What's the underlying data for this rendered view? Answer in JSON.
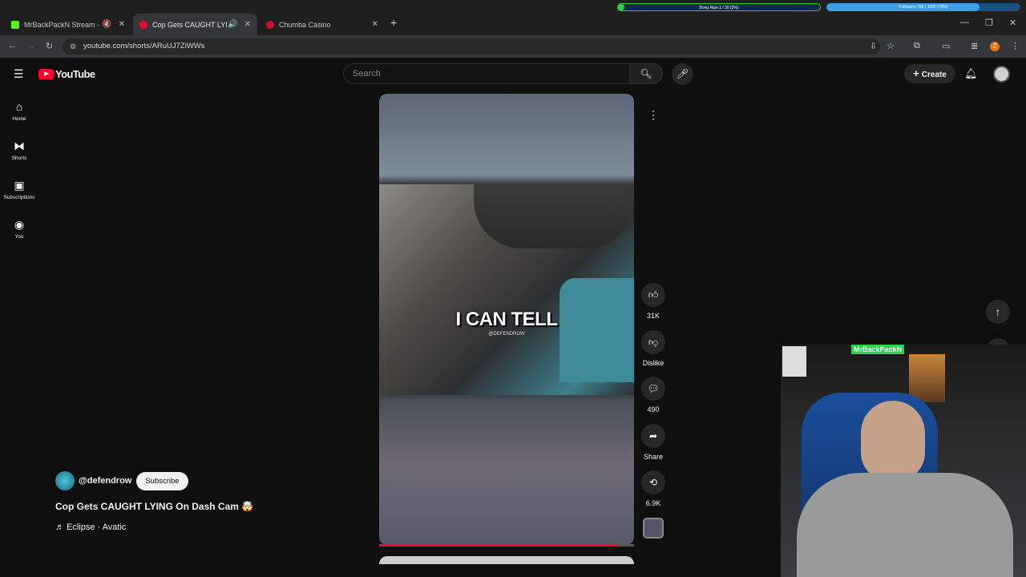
{
  "browser": {
    "tabs": [
      {
        "title": "MrBackPackN Stream - Wa",
        "color": "#53fc18"
      },
      {
        "title": "Cop Gets CAUGHT LYING O",
        "color": "#ff0033"
      },
      {
        "title": "Chumba Casino",
        "color": "#c8102e"
      }
    ],
    "url": "youtube.com/shorts/ARuUJ7ZiWWs",
    "profile_badge": "Z",
    "bars": {
      "bong": "Bong Rips 1 / 30 (3%)",
      "bong_progress": 0.03,
      "followers": "Followers 786 / 1000 (79%)",
      "followers_progress": 0.79
    }
  },
  "youtube": {
    "logo": "YouTube",
    "search_placeholder": "Search",
    "create_label": "Create",
    "sidebar": [
      {
        "label": "Home",
        "icon": "home-icon"
      },
      {
        "label": "Shorts",
        "icon": "shorts-icon"
      },
      {
        "label": "Subscriptions",
        "icon": "subscriptions-icon"
      },
      {
        "label": "You",
        "icon": "you-icon"
      }
    ],
    "video_caption": "I CAN TELL",
    "video_watermark": "@DEFENDROW",
    "progress": 0.93,
    "actions": {
      "likes": "31K",
      "dislike": "Dislike",
      "comments": "490",
      "share": "Share",
      "remix": "6.9K"
    },
    "channel": "@defendrow",
    "subscribe": "Subscribe",
    "title": "Cop Gets CAUGHT LYING On Dash Cam 🤯",
    "music": "Eclipse · Avatic",
    "overlay_name": "MrBackPackN"
  }
}
